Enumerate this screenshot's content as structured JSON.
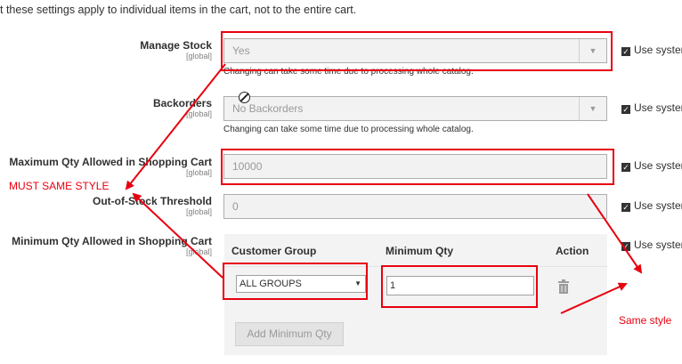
{
  "note": "t these settings apply to individual items in the cart, not to the entire cart.",
  "scope_label": "[global]",
  "use_system_label": "Use syster",
  "hint_text": "Changing can take some time due to processing whole catalog.",
  "fields": {
    "manage_stock": {
      "label": "Manage Stock",
      "value": "Yes"
    },
    "backorders": {
      "label": "Backorders",
      "value": "No Backorders"
    },
    "max_qty": {
      "label": "Maximum Qty Allowed in Shopping Cart",
      "value": "10000"
    },
    "out_of_stock": {
      "label": "Out-of-Stock Threshold",
      "value": "0"
    },
    "min_qty": {
      "label": "Minimum Qty Allowed in Shopping Cart"
    }
  },
  "grid": {
    "col_customer_group": "Customer Group",
    "col_minimum_qty": "Minimum Qty",
    "col_action": "Action",
    "row": {
      "customer_group": "ALL GROUPS",
      "minimum_qty": "1"
    },
    "add_button": "Add Minimum Qty"
  },
  "annotations": {
    "must_same_style": "MUST SAME STYLE",
    "same_style": "Same style"
  },
  "colors": {
    "annotation_red": "#e8000f",
    "disabled_field_bg": "#f2f2f2"
  }
}
